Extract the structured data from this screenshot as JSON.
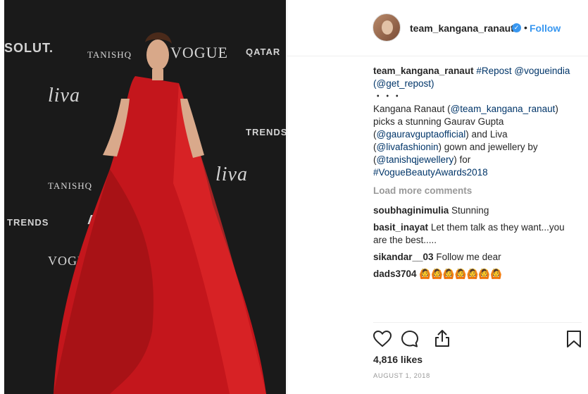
{
  "header": {
    "username": "team_kangana_ranaut",
    "separator": "•",
    "follow_label": "Follow"
  },
  "photo": {
    "backdrop": [
      "SOLUT.",
      "TANISHQ",
      "VOGUE",
      "QATAR",
      "liva",
      "TRENDS",
      "TANISHQ",
      "liva",
      "TRENDS",
      "ABS",
      "VOGUE"
    ]
  },
  "caption": {
    "user": "team_kangana_ranaut",
    "line1_tags": "#Repost @vogueindia",
    "line2": "(@get_repost)",
    "dots": "・・・",
    "body_a": "Kangana Ranaut (",
    "body_link1": "@team_kangana_ranaut",
    "body_b": ") picks a stunning Gaurav Gupta (",
    "body_link2": "@gauravguptaofficial",
    "body_c": ") and Liva (",
    "body_link3": "@livafashionin",
    "body_d": ") gown and jewellery by (",
    "body_link4": "@tanishqjewellery",
    "body_e": ") for ",
    "body_link5": "#VogueBeautyAwards2018"
  },
  "load_more": "Load more comments",
  "comments": [
    {
      "user": "soubhaginimulia",
      "text": "Stunning"
    },
    {
      "user": "basit_inayat",
      "text": "Let them talk as they want...you are the best....."
    },
    {
      "user": "sikandar__03",
      "text": "Follow me dear"
    },
    {
      "user": "dads3704",
      "text": "🙆🙆🙆🙆🙆🙆🙆"
    }
  ],
  "actions": {
    "likes": "4,816 likes",
    "date": "AUGUST 1, 2018"
  },
  "icons": [
    "heart-icon",
    "comment-icon",
    "share-icon",
    "bookmark-icon",
    "verified-icon"
  ]
}
